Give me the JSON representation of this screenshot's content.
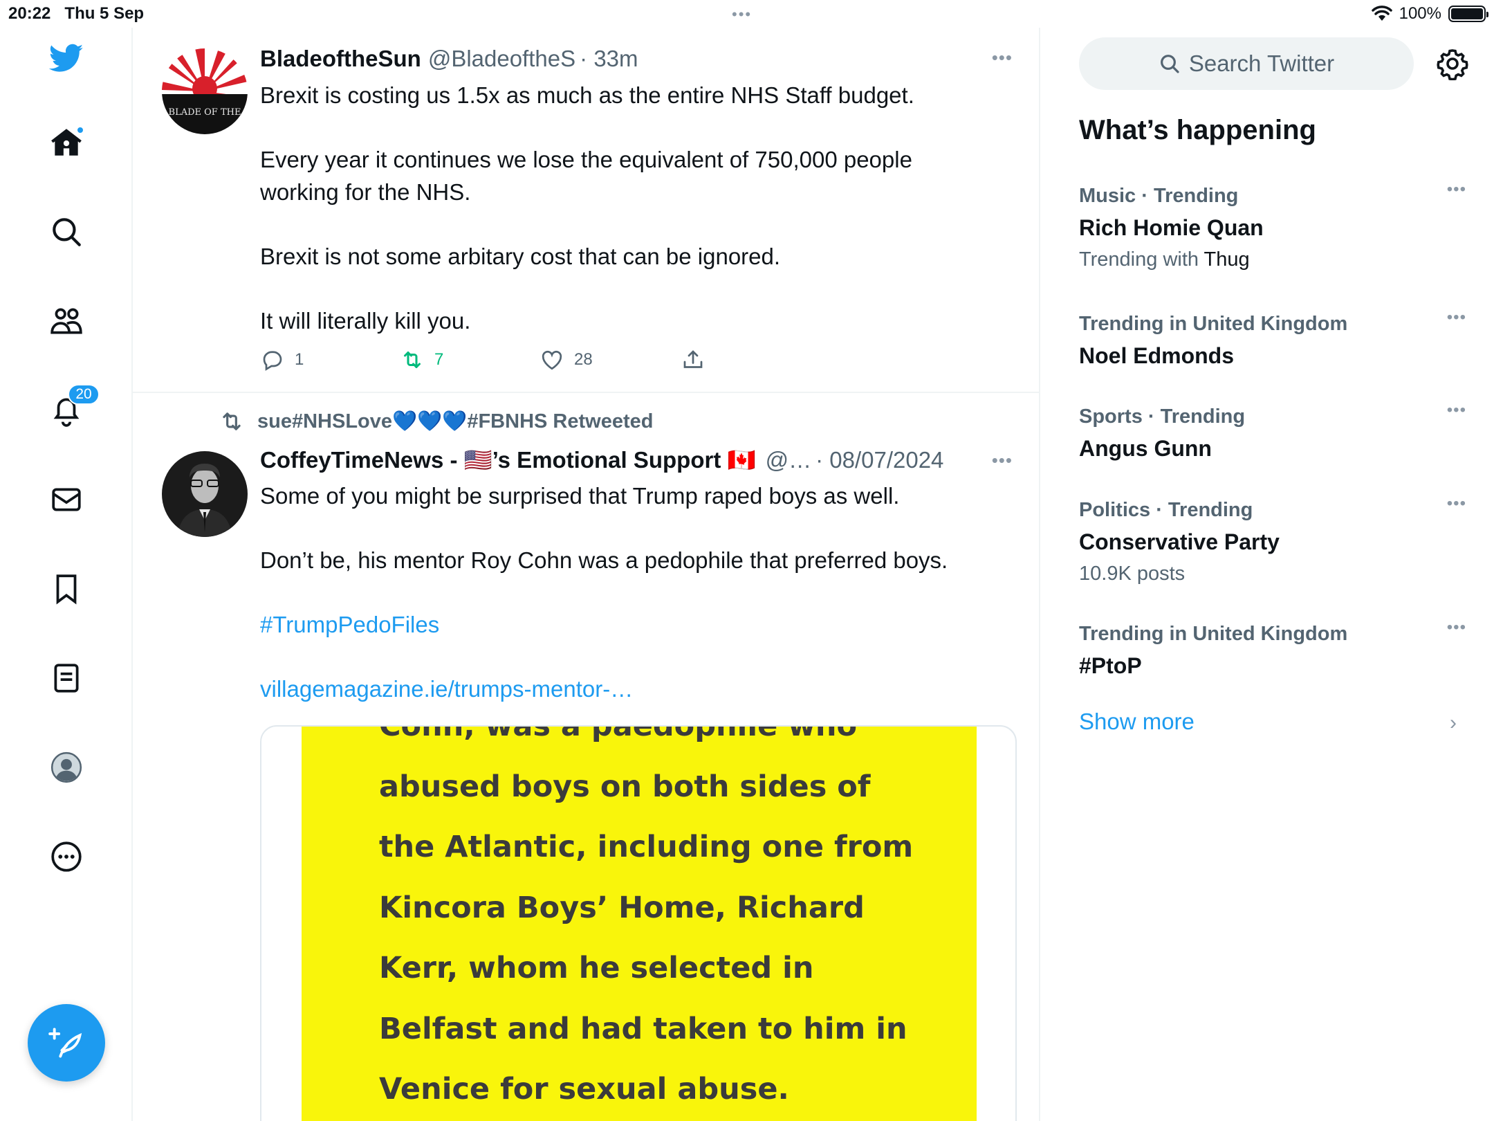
{
  "status": {
    "time": "20:22",
    "date": "Thu 5 Sep",
    "battery": "100%"
  },
  "nav": {
    "notifications_badge": "20"
  },
  "tweets": [
    {
      "display_name": "BladeoftheSun",
      "handle": "@BladeoftheS",
      "time": "· 33m",
      "paragraphs": [
        "Brexit is costing us 1.5x as much as the entire NHS Staff budget.",
        "Every year it continues we lose the equivalent of 750,000 people working for the NHS.",
        "Brexit is not some arbitary cost that can be ignored.",
        "It will literally kill you."
      ],
      "replies": "1",
      "retweets": "7",
      "likes": "28",
      "avatar_text": "BLADE OF THE"
    },
    {
      "retweeted_by": "sue#NHSLove💙💙💙#FBNHS Retweeted",
      "display_name": "CoffeyTimeNews - 🇺🇸’s Emotional Support 🇨🇦",
      "handle": "@…",
      "time": "· 08/07/2024",
      "paragraphs": [
        "Some of you might be surprised that Trump raped boys as well.",
        "Don’t be, his mentor Roy Cohn was a pedophile that preferred boys."
      ],
      "hashtag": "#TrumpPedoFiles",
      "link": "villagemagazine.ie/trumps-mentor-…",
      "media_lines": [
        "Cohn, was a paedophile who",
        "abused boys on both sides of",
        "the Atlantic, including one from",
        "Kincora Boys’ Home, Richard",
        "Kerr, whom he selected in",
        "Belfast and had taken to him in",
        "Venice for sexual abuse."
      ]
    }
  ],
  "right": {
    "search_placeholder": "Search Twitter",
    "section_title": "What’s happening",
    "trends": [
      {
        "category": "Music · Trending",
        "name": "Rich Homie Quan",
        "meta_prefix": "Trending with ",
        "meta_bold": "Thug"
      },
      {
        "category": "Trending in United Kingdom",
        "name": "Noel Edmonds",
        "meta_prefix": "",
        "meta_bold": ""
      },
      {
        "category": "Sports · Trending",
        "name": "Angus Gunn",
        "meta_prefix": "",
        "meta_bold": ""
      },
      {
        "category": "Politics · Trending",
        "name": "Conservative Party",
        "meta_prefix": "10.9K posts",
        "meta_bold": ""
      },
      {
        "category": "Trending in United Kingdom",
        "name": "#PtoP",
        "meta_prefix": "",
        "meta_bold": ""
      }
    ],
    "show_more": "Show more"
  },
  "colors": {
    "accent": "#1d9bf0",
    "retweet_green": "#00ba7c",
    "muted": "#536471",
    "media_yellow": "#f9f50b"
  },
  "icons": [
    "twitter-bird-icon",
    "home-icon",
    "search-icon",
    "communities-icon",
    "bell-icon",
    "mail-icon",
    "bookmark-icon",
    "lists-icon",
    "profile-icon",
    "more-circle-icon",
    "compose-icon",
    "reply-icon",
    "retweet-icon",
    "like-icon",
    "share-icon",
    "gear-icon",
    "chevron-right-icon",
    "wifi-icon"
  ]
}
